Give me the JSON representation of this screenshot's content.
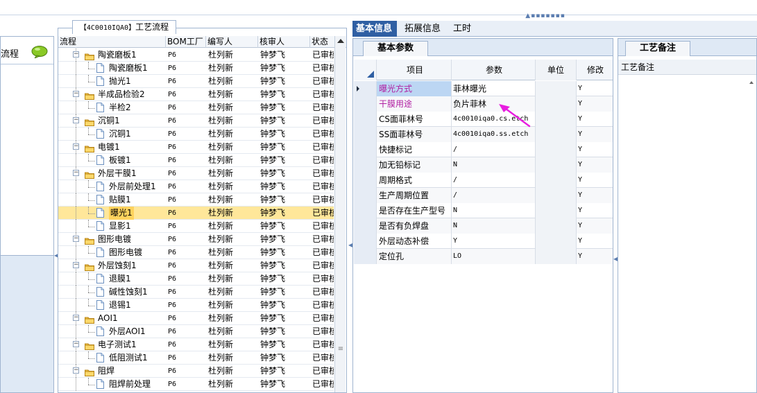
{
  "left_pane": {
    "title": "流程",
    "icon": "speech-bubble-icon"
  },
  "process_tab": {
    "code": "【4C0010IQA0】",
    "title": "工艺流程"
  },
  "tree": {
    "columns": {
      "flow": "流程",
      "factory": "BOM工厂",
      "editor": "编写人",
      "reviewer": "核审人",
      "status": "状态"
    },
    "rows": [
      {
        "type": "group",
        "label": "陶瓷磨板1",
        "factory": "P6",
        "editor": "杜列新",
        "reviewer": "钟梦飞",
        "status": "已审核"
      },
      {
        "type": "leaf",
        "label": "陶瓷磨板1",
        "factory": "P6",
        "editor": "杜列新",
        "reviewer": "钟梦飞",
        "status": "已审核"
      },
      {
        "type": "leaf",
        "label": "抛光1",
        "factory": "P6",
        "editor": "杜列新",
        "reviewer": "钟梦飞",
        "status": "已审核"
      },
      {
        "type": "group",
        "label": "半成品检验2",
        "factory": "P6",
        "editor": "杜列新",
        "reviewer": "钟梦飞",
        "status": "已审核"
      },
      {
        "type": "leaf",
        "label": "半检2",
        "factory": "P6",
        "editor": "杜列新",
        "reviewer": "钟梦飞",
        "status": "已审核"
      },
      {
        "type": "group",
        "label": "沉铜1",
        "factory": "P6",
        "editor": "杜列新",
        "reviewer": "钟梦飞",
        "status": "已审核"
      },
      {
        "type": "leaf",
        "label": "沉铜1",
        "factory": "P6",
        "editor": "杜列新",
        "reviewer": "钟梦飞",
        "status": "已审核"
      },
      {
        "type": "group",
        "label": "电镀1",
        "factory": "P6",
        "editor": "杜列新",
        "reviewer": "钟梦飞",
        "status": "已审核"
      },
      {
        "type": "leaf",
        "label": "板镀1",
        "factory": "P6",
        "editor": "杜列新",
        "reviewer": "钟梦飞",
        "status": "已审核"
      },
      {
        "type": "group",
        "label": "外层干膜1",
        "factory": "P6",
        "editor": "杜列新",
        "reviewer": "钟梦飞",
        "status": "已审核"
      },
      {
        "type": "leaf",
        "label": "外层前处理1",
        "factory": "P6",
        "editor": "杜列新",
        "reviewer": "钟梦飞",
        "status": "已审核"
      },
      {
        "type": "leaf",
        "label": "贴膜1",
        "factory": "P6",
        "editor": "杜列新",
        "reviewer": "钟梦飞",
        "status": "已审核"
      },
      {
        "type": "leaf",
        "label": "曝光1",
        "factory": "P6",
        "editor": "杜列新",
        "reviewer": "钟梦飞",
        "status": "已审核",
        "selected": true
      },
      {
        "type": "leaf",
        "label": "显影1",
        "factory": "P6",
        "editor": "杜列新",
        "reviewer": "钟梦飞",
        "status": "已审核"
      },
      {
        "type": "group",
        "label": "图形电镀",
        "factory": "P6",
        "editor": "杜列新",
        "reviewer": "钟梦飞",
        "status": "已审核"
      },
      {
        "type": "leaf",
        "label": "图形电镀",
        "factory": "P6",
        "editor": "杜列新",
        "reviewer": "钟梦飞",
        "status": "已审核"
      },
      {
        "type": "group",
        "label": "外层蚀刻1",
        "factory": "P6",
        "editor": "杜列新",
        "reviewer": "钟梦飞",
        "status": "已审核"
      },
      {
        "type": "leaf",
        "label": "退膜1",
        "factory": "P6",
        "editor": "杜列新",
        "reviewer": "钟梦飞",
        "status": "已审核"
      },
      {
        "type": "leaf",
        "label": "碱性蚀刻1",
        "factory": "P6",
        "editor": "杜列新",
        "reviewer": "钟梦飞",
        "status": "已审核"
      },
      {
        "type": "leaf",
        "label": "退锡1",
        "factory": "P6",
        "editor": "杜列新",
        "reviewer": "钟梦飞",
        "status": "已审核"
      },
      {
        "type": "group",
        "label": "AOI1",
        "factory": "P6",
        "editor": "杜列新",
        "reviewer": "钟梦飞",
        "status": "已审核"
      },
      {
        "type": "leaf",
        "label": "外层AOI1",
        "factory": "P6",
        "editor": "杜列新",
        "reviewer": "钟梦飞",
        "status": "已审核"
      },
      {
        "type": "group",
        "label": "电子测试1",
        "factory": "P6",
        "editor": "杜列新",
        "reviewer": "钟梦飞",
        "status": "已审核"
      },
      {
        "type": "leaf",
        "label": "低阻测试1",
        "factory": "P6",
        "editor": "杜列新",
        "reviewer": "钟梦飞",
        "status": "已审核"
      },
      {
        "type": "group",
        "label": "阻焊",
        "factory": "P6",
        "editor": "杜列新",
        "reviewer": "钟梦飞",
        "status": "已审核"
      },
      {
        "type": "leaf",
        "label": "阻焊前处理",
        "factory": "P6",
        "editor": "杜列新",
        "reviewer": "钟梦飞",
        "status": "已审核"
      }
    ]
  },
  "right_tabs": [
    "基本信息",
    "拓展信息",
    "工时"
  ],
  "params": {
    "subtab": "基本参数",
    "columns": {
      "name": "项目",
      "param": "参数",
      "unit": "单位",
      "modify": "修改"
    },
    "rows": [
      {
        "name": "曝光方式",
        "param": "菲林曝光",
        "unit": "",
        "modify": "Y",
        "current": true,
        "highlight": "red"
      },
      {
        "name": "干膜用途",
        "param": "负片菲林",
        "unit": "",
        "modify": "Y",
        "highlight": "red"
      },
      {
        "name": "CS面菲林号",
        "param": "4c0010iqa0.cs.etch",
        "unit": "",
        "modify": "Y"
      },
      {
        "name": "SS面菲林号",
        "param": "4c0010iqa0.ss.etch",
        "unit": "",
        "modify": "Y"
      },
      {
        "name": "快捷标记",
        "param": "/",
        "unit": "",
        "modify": "Y"
      },
      {
        "name": "加无铅标记",
        "param": "N",
        "unit": "",
        "modify": "Y"
      },
      {
        "name": "周期格式",
        "param": "/",
        "unit": "",
        "modify": "Y"
      },
      {
        "name": "生产周期位置",
        "param": "/",
        "unit": "",
        "modify": "Y"
      },
      {
        "name": "是否存在生产型号",
        "param": "N",
        "unit": "",
        "modify": "Y"
      },
      {
        "name": "是否有负焊盘",
        "param": "N",
        "unit": "",
        "modify": "Y"
      },
      {
        "name": "外层动态补偿",
        "param": "Y",
        "unit": "",
        "modify": "Y"
      },
      {
        "name": "定位孔",
        "param": "LO",
        "unit": "",
        "modify": "Y"
      }
    ]
  },
  "notes": {
    "subtab": "工艺备注",
    "label": "工艺备注"
  },
  "colors": {
    "accent": "#2f5fa3",
    "selected_row": "#ffe79a",
    "highlight_text": "#b01fa2",
    "annotation_arrow": "#e81ee0"
  }
}
